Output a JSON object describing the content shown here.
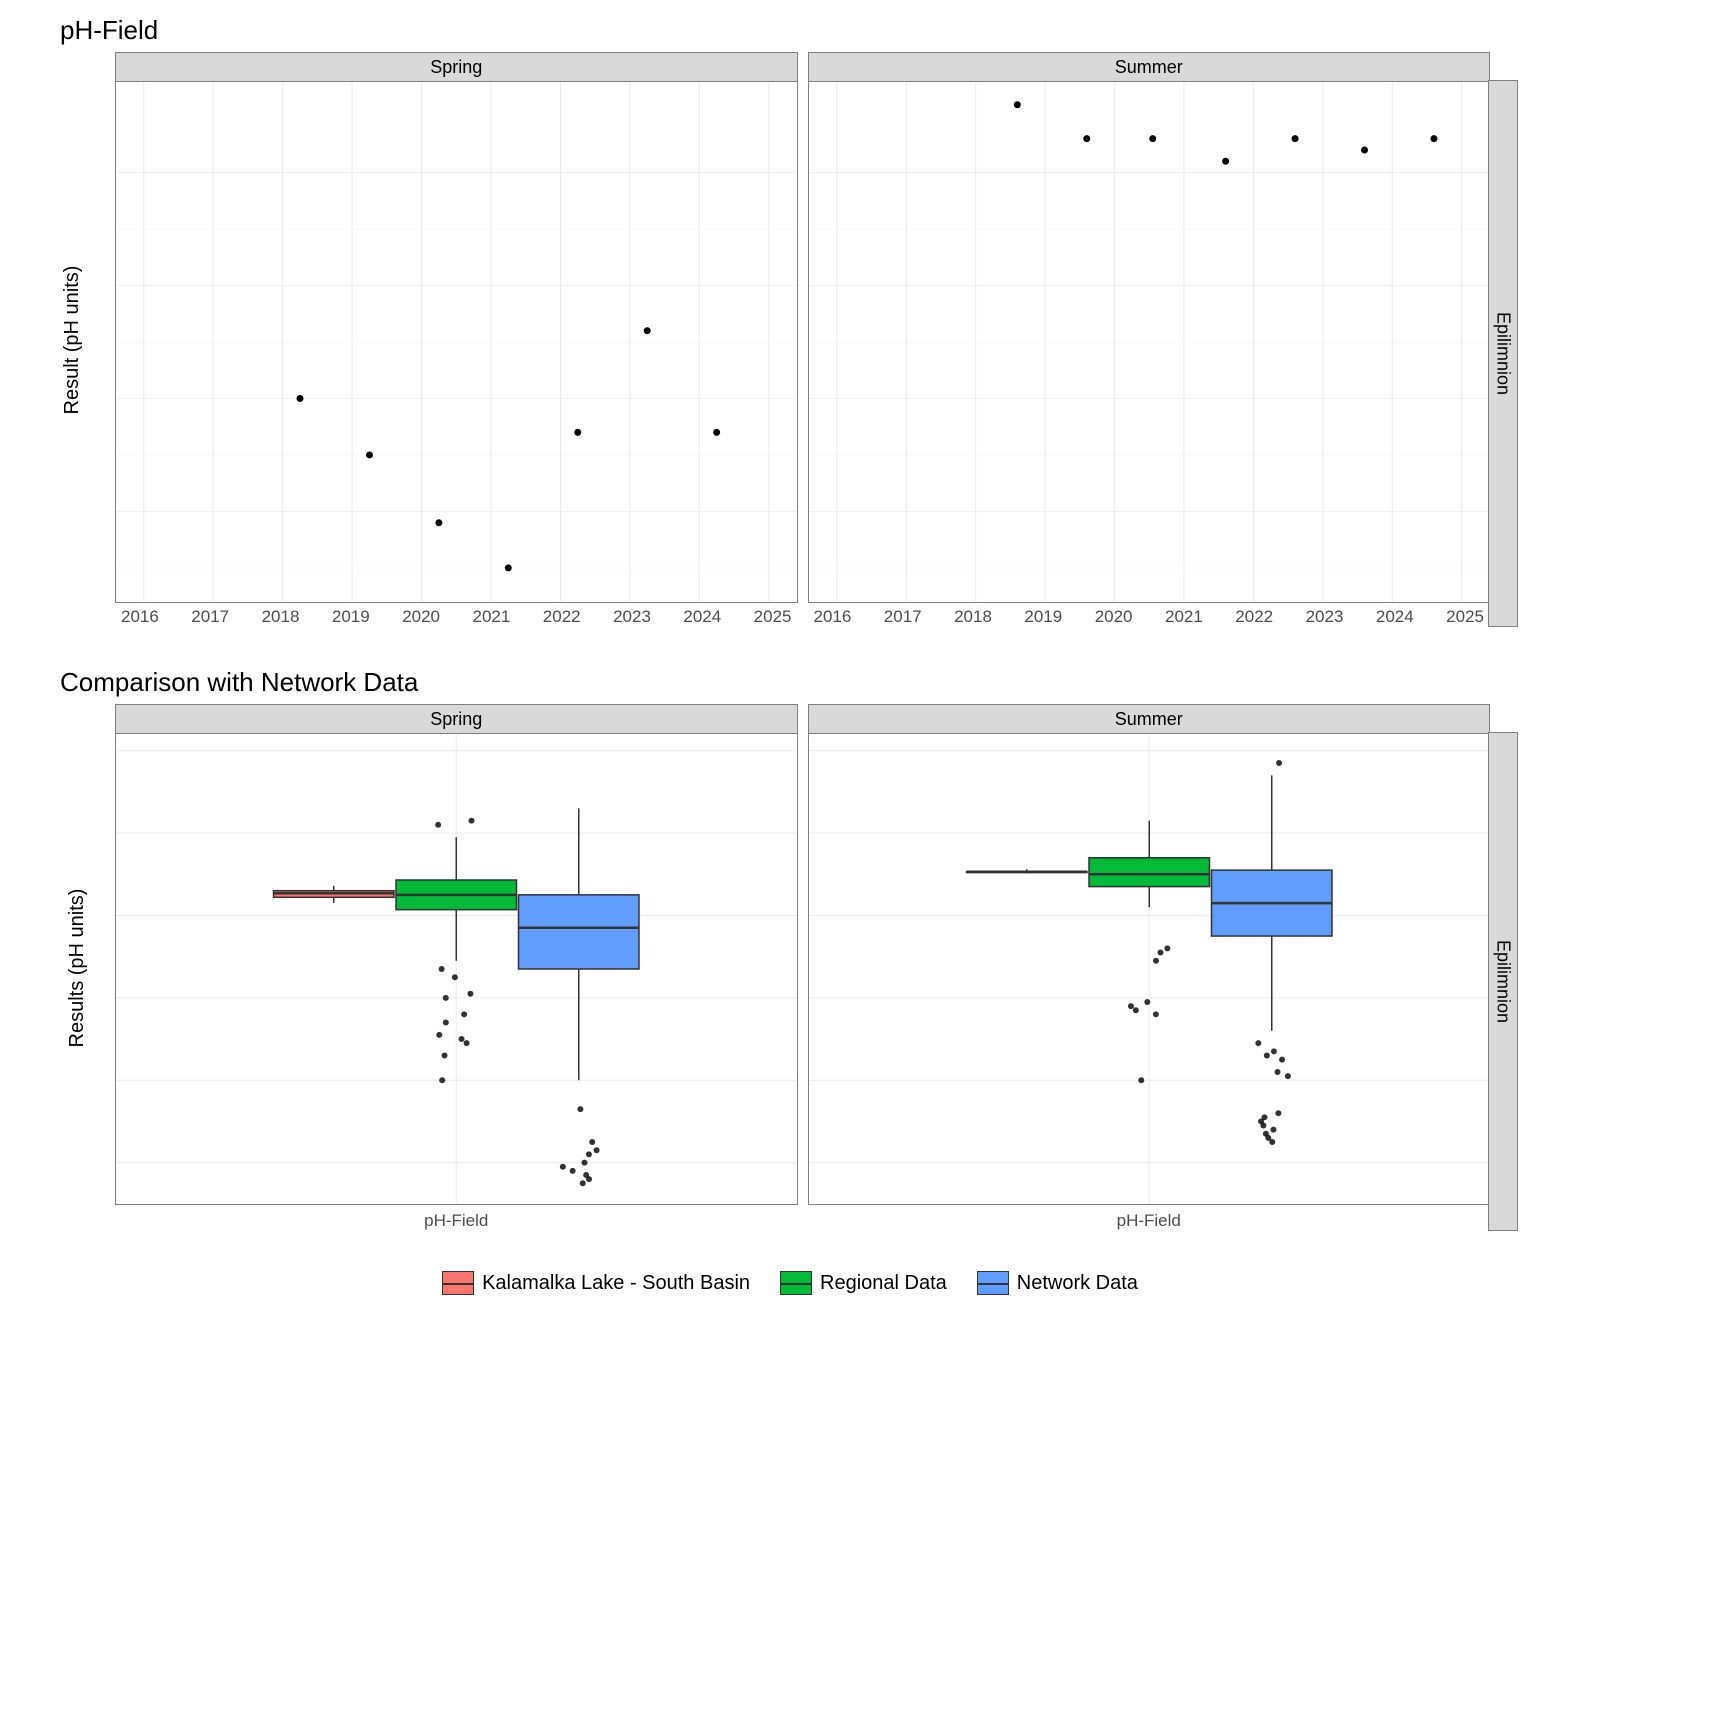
{
  "chart_data": [
    {
      "type": "scatter",
      "title": "pH-Field",
      "ylabel": "Result (pH units)",
      "right_strip": "Epilimnion",
      "x_ticks": [
        2016,
        2017,
        2018,
        2019,
        2020,
        2021,
        2022,
        2023,
        2024,
        2025
      ],
      "y_ticks": [
        8.2,
        8.3,
        8.4,
        8.5
      ],
      "ylim": [
        8.12,
        8.58
      ],
      "xlim": [
        2015.6,
        2025.4
      ],
      "facets": [
        {
          "name": "Spring",
          "points": [
            {
              "x": 2018.25,
              "y": 8.3
            },
            {
              "x": 2019.25,
              "y": 8.25
            },
            {
              "x": 2020.25,
              "y": 8.19
            },
            {
              "x": 2021.25,
              "y": 8.15
            },
            {
              "x": 2022.25,
              "y": 8.27
            },
            {
              "x": 2023.25,
              "y": 8.36
            },
            {
              "x": 2024.25,
              "y": 8.27
            }
          ]
        },
        {
          "name": "Summer",
          "points": [
            {
              "x": 2018.6,
              "y": 8.56
            },
            {
              "x": 2019.6,
              "y": 8.53
            },
            {
              "x": 2020.55,
              "y": 8.53
            },
            {
              "x": 2021.6,
              "y": 8.51
            },
            {
              "x": 2022.6,
              "y": 8.53
            },
            {
              "x": 2023.6,
              "y": 8.52
            },
            {
              "x": 2024.6,
              "y": 8.53
            }
          ]
        }
      ]
    },
    {
      "type": "boxplot",
      "title": "Comparison with Network Data",
      "ylabel": "Results (pH units)",
      "xlabel": "pH-Field",
      "right_strip": "Epilimnion",
      "y_ticks": [
        5,
        6,
        7,
        8,
        9,
        10
      ],
      "ylim": [
        4.5,
        10.2
      ],
      "legend": [
        {
          "name": "Kalamalka Lake - South Basin",
          "fill": "#F8766D"
        },
        {
          "name": "Regional Data",
          "fill": "#00BA38"
        },
        {
          "name": "Network Data",
          "fill": "#619CFF"
        }
      ],
      "facets": [
        {
          "name": "Spring",
          "boxes": [
            {
              "series": "Kalamalka Lake - South Basin",
              "min": 8.15,
              "q1": 8.22,
              "median": 8.27,
              "q3": 8.3,
              "max": 8.36,
              "outliers": []
            },
            {
              "series": "Regional Data",
              "min": 7.45,
              "q1": 8.07,
              "median": 8.25,
              "q3": 8.43,
              "max": 8.95,
              "outliers": [
                9.15,
                9.1,
                7.35,
                7.25,
                7.05,
                7.0,
                6.8,
                6.7,
                6.55,
                6.5,
                6.45,
                6.3,
                6.0
              ]
            },
            {
              "series": "Network Data",
              "min": 6.0,
              "q1": 7.35,
              "median": 7.85,
              "q3": 8.25,
              "max": 9.3,
              "outliers": [
                5.65,
                5.25,
                5.15,
                5.1,
                5.0,
                4.95,
                4.9,
                4.85,
                4.8,
                4.75
              ]
            }
          ]
        },
        {
          "name": "Summer",
          "boxes": [
            {
              "series": "Kalamalka Lake - South Basin",
              "min": 8.51,
              "q1": 8.52,
              "median": 8.53,
              "q3": 8.53,
              "max": 8.56,
              "outliers": []
            },
            {
              "series": "Regional Data",
              "min": 8.1,
              "q1": 8.35,
              "median": 8.5,
              "q3": 8.7,
              "max": 9.15,
              "outliers": [
                7.6,
                7.55,
                7.45,
                6.95,
                6.9,
                6.85,
                6.8,
                6.0
              ]
            },
            {
              "series": "Network Data",
              "min": 6.6,
              "q1": 7.75,
              "median": 8.15,
              "q3": 8.55,
              "max": 9.7,
              "outliers": [
                9.85,
                6.45,
                6.35,
                6.3,
                6.25,
                6.1,
                6.05,
                5.6,
                5.55,
                5.5,
                5.45,
                5.4,
                5.35,
                5.3,
                5.25
              ]
            }
          ]
        }
      ]
    }
  ]
}
